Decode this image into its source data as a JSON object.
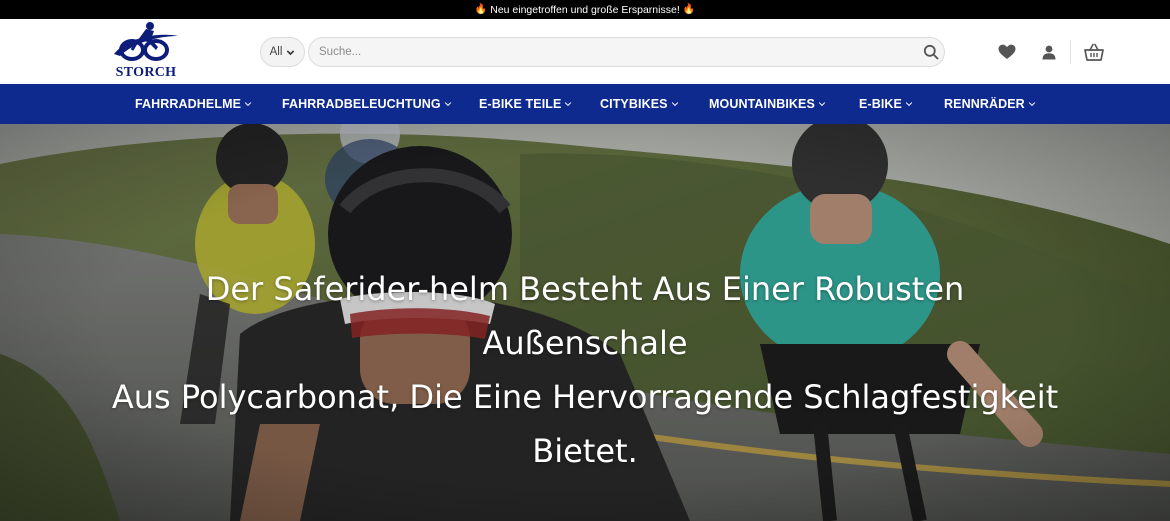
{
  "announcement": {
    "text": "Neu eingetroffen und große Ersparnisse!",
    "flame_icon": "fire-icon"
  },
  "header": {
    "logo_text": "STORCH",
    "search": {
      "category_value": "All",
      "placeholder": "Suche...",
      "value": ""
    },
    "icons": [
      "heart-icon",
      "user-icon",
      "basket-icon"
    ]
  },
  "nav": {
    "items": [
      {
        "label": "FAHRRADHELME"
      },
      {
        "label": "FAHRRADBELEUCHTUNG"
      },
      {
        "label": "E-BIKE TEILE"
      },
      {
        "label": "CITYBIKES"
      },
      {
        "label": "MOUNTAINBIKES"
      },
      {
        "label": "E-BIKE"
      },
      {
        "label": "RENNRÄDER"
      }
    ]
  },
  "hero": {
    "line1": "Der Saferider-helm Besteht Aus Einer Robusten Außenschale",
    "line2": "Aus Polycarbonat, Die Eine Hervorragende Schlagfestigkeit",
    "line3": "Bietet."
  },
  "colors": {
    "nav_bg": "#0f2a8f",
    "logo_blue": "#0d1d7a",
    "topbar_bg": "#000000"
  }
}
